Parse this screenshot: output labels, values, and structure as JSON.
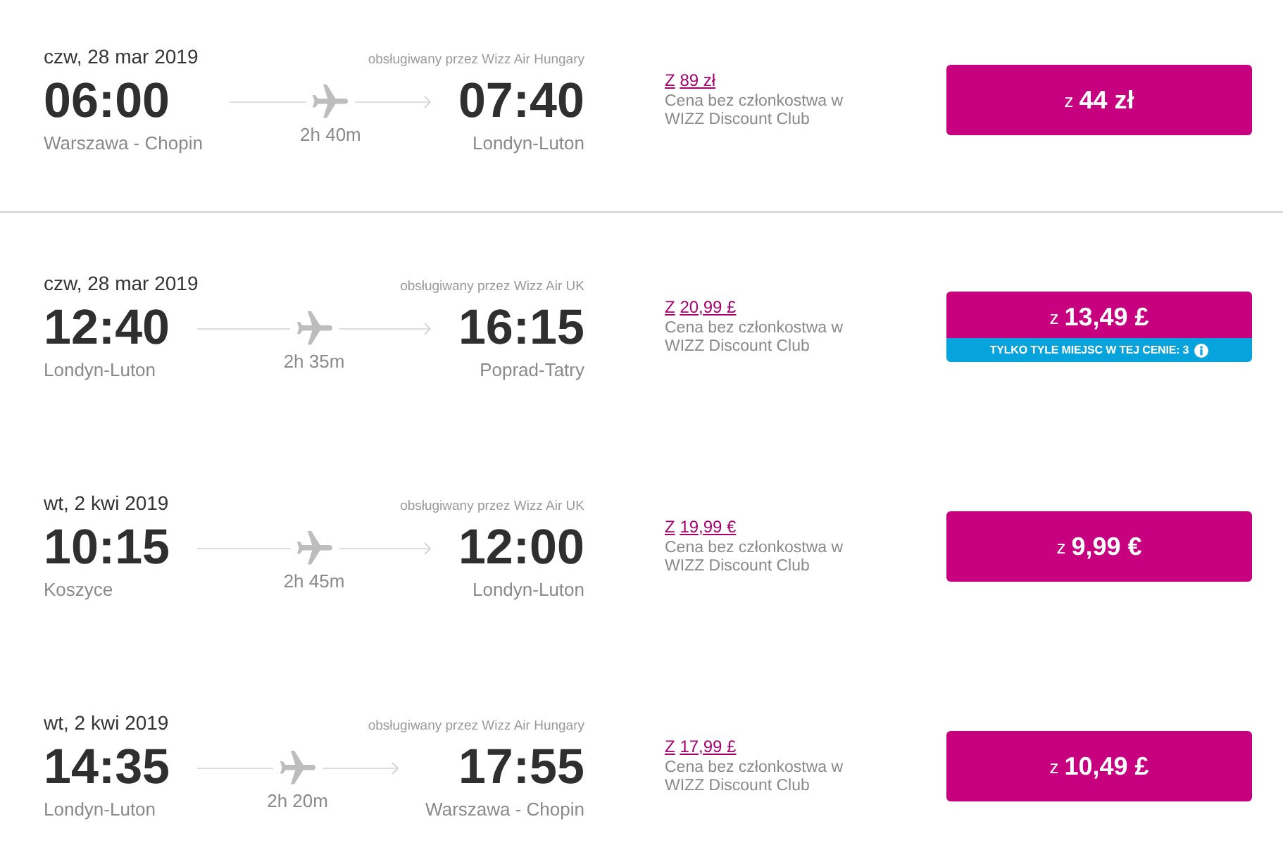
{
  "flights": [
    {
      "date": "czw, 28 mar 2019",
      "operator": "obsługiwany przez Wizz Air Hungary",
      "departure": {
        "time": "06:00",
        "airport": "Warszawa - Chopin"
      },
      "duration": "2h 40m",
      "arrival": {
        "time": "07:40",
        "airport": "Londyn-Luton"
      },
      "regular_price": {
        "prefix": "Z",
        "amount": "89 zł"
      },
      "regular_price_note": "Cena bez członkostwa w WIZZ Discount Club",
      "fare": {
        "prefix": "z",
        "amount": "44 zł"
      },
      "divider_below": true
    },
    {
      "date": "czw, 28 mar 2019",
      "operator": "obsługiwany przez Wizz Air UK",
      "departure": {
        "time": "12:40",
        "airport": "Londyn-Luton"
      },
      "duration": "2h 35m",
      "arrival": {
        "time": "16:15",
        "airport": "Poprad-Tatry"
      },
      "regular_price": {
        "prefix": "Z",
        "amount": "20,99 £"
      },
      "regular_price_note": "Cena bez członkostwa w WIZZ Discount Club",
      "fare": {
        "prefix": "z",
        "amount": "13,49 £"
      },
      "seats_notice": "TYLKO TYLE MIEJSC W TEJ CENIE: 3",
      "divider_below": false
    },
    {
      "date": "wt, 2 kwi 2019",
      "operator": "obsługiwany przez Wizz Air UK",
      "departure": {
        "time": "10:15",
        "airport": "Koszyce"
      },
      "duration": "2h 45m",
      "arrival": {
        "time": "12:00",
        "airport": "Londyn-Luton"
      },
      "regular_price": {
        "prefix": "Z",
        "amount": "19,99 €"
      },
      "regular_price_note": "Cena bez członkostwa w WIZZ Discount Club",
      "fare": {
        "prefix": "z",
        "amount": "9,99 €"
      },
      "divider_below": false
    },
    {
      "date": "wt, 2 kwi 2019",
      "operator": "obsługiwany przez Wizz Air Hungary",
      "departure": {
        "time": "14:35",
        "airport": "Londyn-Luton"
      },
      "duration": "2h 20m",
      "arrival": {
        "time": "17:55",
        "airport": "Warszawa - Chopin"
      },
      "regular_price": {
        "prefix": "Z",
        "amount": "17,99 £"
      },
      "regular_price_note": "Cena bez członkostwa w WIZZ Discount Club",
      "fare": {
        "prefix": "z",
        "amount": "10,49 £"
      },
      "divider_below": false
    }
  ]
}
